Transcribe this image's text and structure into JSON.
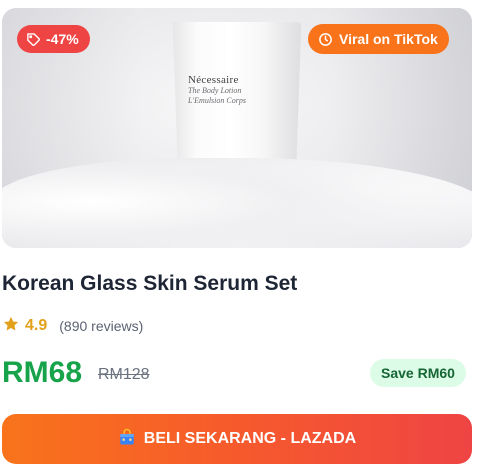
{
  "product": {
    "title": "Korean Glass Skin Serum Set",
    "image_label": {
      "brand": "Nécessaire",
      "line1": "The Body Lotion",
      "line2": "L'Emulsion Corps"
    }
  },
  "badges": {
    "discount": {
      "label": "-47%",
      "icon": "tag-icon",
      "color": "#ef4444"
    },
    "viral": {
      "label": "Viral on TikTok",
      "icon": "clock-icon",
      "color": "#f9731b"
    }
  },
  "rating": {
    "icon": "star-icon",
    "value": "4.9",
    "reviews": "(890 reviews)",
    "color": "#e3a11b"
  },
  "pricing": {
    "price": "RM68",
    "original_price": "RM128",
    "save_label": "Save RM60",
    "price_color": "#16a34a"
  },
  "cta": {
    "icon": "shopping-bag-icon",
    "label": "BELI SEKARANG - LAZADA"
  }
}
